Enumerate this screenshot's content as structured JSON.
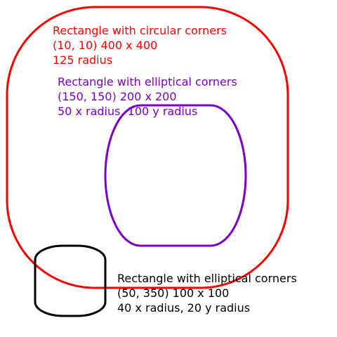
{
  "shapes": [
    {
      "name": "rect-circular-corners",
      "color": "#ff0000",
      "label_lines": [
        "Rectangle with circular corners",
        "(10, 10) 400 x 400",
        "125 radius"
      ]
    },
    {
      "name": "rect-elliptical-corners-purple",
      "color": "#7b00c8",
      "label_lines": [
        "Rectangle with elliptical corners",
        "(150, 150) 200 x 200",
        "50 x radius, 100 y radius"
      ]
    },
    {
      "name": "rect-elliptical-corners-black",
      "color": "#000000",
      "label_lines": [
        "Rectangle with elliptical corners",
        "(50, 350) 100 x 100",
        "40 x radius, 20 y radius"
      ]
    }
  ]
}
